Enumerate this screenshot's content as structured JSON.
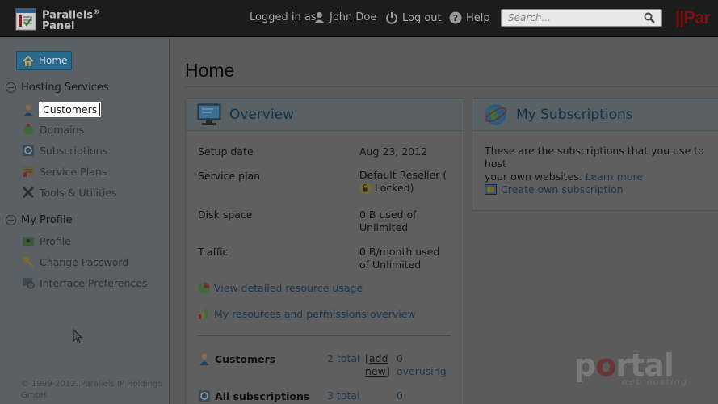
{
  "brand": {
    "line1": "Parallels",
    "reg": "®",
    "line2": "Panel",
    "right_mark": "||Par"
  },
  "topnav": {
    "logged_in_prefix": "Logged in as",
    "user_name": "John Doe",
    "logout_label": "Log out",
    "help_label": "Help",
    "search_placeholder": "Search..."
  },
  "sidebar": {
    "home_label": "Home",
    "sections": [
      {
        "title": "Hosting Services",
        "items": [
          "Customers",
          "Domains",
          "Subscriptions",
          "Service Plans",
          "Tools & Utilities"
        ]
      },
      {
        "title": "My Profile",
        "items": [
          "Profile",
          "Change Password",
          "Interface Preferences"
        ]
      }
    ],
    "copyright_line1": "© 1999-2012. Parallels IP Holdings",
    "copyright_line2": "GmbH."
  },
  "main": {
    "title": "Home",
    "overview": {
      "title": "Overview",
      "rows": [
        {
          "label": "Setup date",
          "value": "Aug 23, 2012"
        },
        {
          "label": "Service plan",
          "value_line1": "Default Reseller (",
          "value_line2": "Locked)"
        },
        {
          "label": "Disk space",
          "value_line1": "0 B used of",
          "value_line2": "Unlimited"
        },
        {
          "label": "Traffic",
          "value_line1": "0 B/month used",
          "value_line2": "of Unlimited"
        }
      ],
      "resource_usage_link": "View detailed resource usage",
      "permissions_link": "My resources and permissions overview",
      "customers": {
        "label": "Customers",
        "total": "2 total",
        "add_line1": "[add",
        "add_line2": "new]",
        "overusing_count": "0",
        "overusing_label": "overusing"
      },
      "all_subscriptions": {
        "label": "All subscriptions",
        "total": "3 total",
        "count": "0"
      }
    },
    "subscriptions": {
      "title": "My Subscriptions",
      "desc_line1": "These are the subscriptions that you use to host",
      "desc_line2": "your own websites.",
      "learn_more": "Learn more",
      "create_link": "Create own subscription"
    }
  },
  "watermark": {
    "text_p": "p",
    "text_o": "o",
    "text_rtal": "rtal",
    "sub": "web hosting"
  }
}
